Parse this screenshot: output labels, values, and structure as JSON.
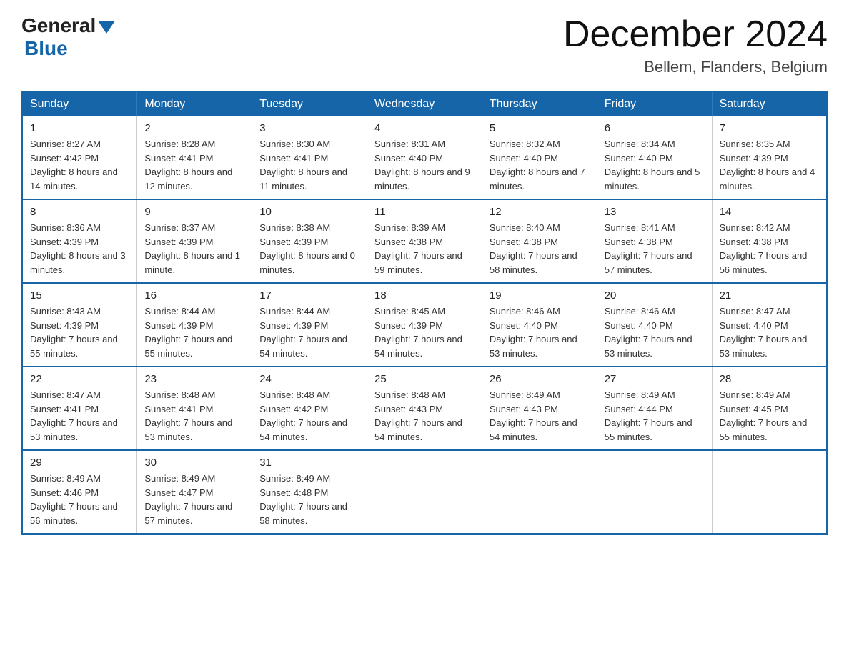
{
  "header": {
    "logo_general": "General",
    "logo_blue": "Blue",
    "month_title": "December 2024",
    "location": "Bellem, Flanders, Belgium"
  },
  "days_of_week": [
    "Sunday",
    "Monday",
    "Tuesday",
    "Wednesday",
    "Thursday",
    "Friday",
    "Saturday"
  ],
  "weeks": [
    [
      {
        "day": "1",
        "sunrise": "8:27 AM",
        "sunset": "4:42 PM",
        "daylight": "8 hours and 14 minutes."
      },
      {
        "day": "2",
        "sunrise": "8:28 AM",
        "sunset": "4:41 PM",
        "daylight": "8 hours and 12 minutes."
      },
      {
        "day": "3",
        "sunrise": "8:30 AM",
        "sunset": "4:41 PM",
        "daylight": "8 hours and 11 minutes."
      },
      {
        "day": "4",
        "sunrise": "8:31 AM",
        "sunset": "4:40 PM",
        "daylight": "8 hours and 9 minutes."
      },
      {
        "day": "5",
        "sunrise": "8:32 AM",
        "sunset": "4:40 PM",
        "daylight": "8 hours and 7 minutes."
      },
      {
        "day": "6",
        "sunrise": "8:34 AM",
        "sunset": "4:40 PM",
        "daylight": "8 hours and 5 minutes."
      },
      {
        "day": "7",
        "sunrise": "8:35 AM",
        "sunset": "4:39 PM",
        "daylight": "8 hours and 4 minutes."
      }
    ],
    [
      {
        "day": "8",
        "sunrise": "8:36 AM",
        "sunset": "4:39 PM",
        "daylight": "8 hours and 3 minutes."
      },
      {
        "day": "9",
        "sunrise": "8:37 AM",
        "sunset": "4:39 PM",
        "daylight": "8 hours and 1 minute."
      },
      {
        "day": "10",
        "sunrise": "8:38 AM",
        "sunset": "4:39 PM",
        "daylight": "8 hours and 0 minutes."
      },
      {
        "day": "11",
        "sunrise": "8:39 AM",
        "sunset": "4:38 PM",
        "daylight": "7 hours and 59 minutes."
      },
      {
        "day": "12",
        "sunrise": "8:40 AM",
        "sunset": "4:38 PM",
        "daylight": "7 hours and 58 minutes."
      },
      {
        "day": "13",
        "sunrise": "8:41 AM",
        "sunset": "4:38 PM",
        "daylight": "7 hours and 57 minutes."
      },
      {
        "day": "14",
        "sunrise": "8:42 AM",
        "sunset": "4:38 PM",
        "daylight": "7 hours and 56 minutes."
      }
    ],
    [
      {
        "day": "15",
        "sunrise": "8:43 AM",
        "sunset": "4:39 PM",
        "daylight": "7 hours and 55 minutes."
      },
      {
        "day": "16",
        "sunrise": "8:44 AM",
        "sunset": "4:39 PM",
        "daylight": "7 hours and 55 minutes."
      },
      {
        "day": "17",
        "sunrise": "8:44 AM",
        "sunset": "4:39 PM",
        "daylight": "7 hours and 54 minutes."
      },
      {
        "day": "18",
        "sunrise": "8:45 AM",
        "sunset": "4:39 PM",
        "daylight": "7 hours and 54 minutes."
      },
      {
        "day": "19",
        "sunrise": "8:46 AM",
        "sunset": "4:40 PM",
        "daylight": "7 hours and 53 minutes."
      },
      {
        "day": "20",
        "sunrise": "8:46 AM",
        "sunset": "4:40 PM",
        "daylight": "7 hours and 53 minutes."
      },
      {
        "day": "21",
        "sunrise": "8:47 AM",
        "sunset": "4:40 PM",
        "daylight": "7 hours and 53 minutes."
      }
    ],
    [
      {
        "day": "22",
        "sunrise": "8:47 AM",
        "sunset": "4:41 PM",
        "daylight": "7 hours and 53 minutes."
      },
      {
        "day": "23",
        "sunrise": "8:48 AM",
        "sunset": "4:41 PM",
        "daylight": "7 hours and 53 minutes."
      },
      {
        "day": "24",
        "sunrise": "8:48 AM",
        "sunset": "4:42 PM",
        "daylight": "7 hours and 54 minutes."
      },
      {
        "day": "25",
        "sunrise": "8:48 AM",
        "sunset": "4:43 PM",
        "daylight": "7 hours and 54 minutes."
      },
      {
        "day": "26",
        "sunrise": "8:49 AM",
        "sunset": "4:43 PM",
        "daylight": "7 hours and 54 minutes."
      },
      {
        "day": "27",
        "sunrise": "8:49 AM",
        "sunset": "4:44 PM",
        "daylight": "7 hours and 55 minutes."
      },
      {
        "day": "28",
        "sunrise": "8:49 AM",
        "sunset": "4:45 PM",
        "daylight": "7 hours and 55 minutes."
      }
    ],
    [
      {
        "day": "29",
        "sunrise": "8:49 AM",
        "sunset": "4:46 PM",
        "daylight": "7 hours and 56 minutes."
      },
      {
        "day": "30",
        "sunrise": "8:49 AM",
        "sunset": "4:47 PM",
        "daylight": "7 hours and 57 minutes."
      },
      {
        "day": "31",
        "sunrise": "8:49 AM",
        "sunset": "4:48 PM",
        "daylight": "7 hours and 58 minutes."
      },
      null,
      null,
      null,
      null
    ]
  ]
}
